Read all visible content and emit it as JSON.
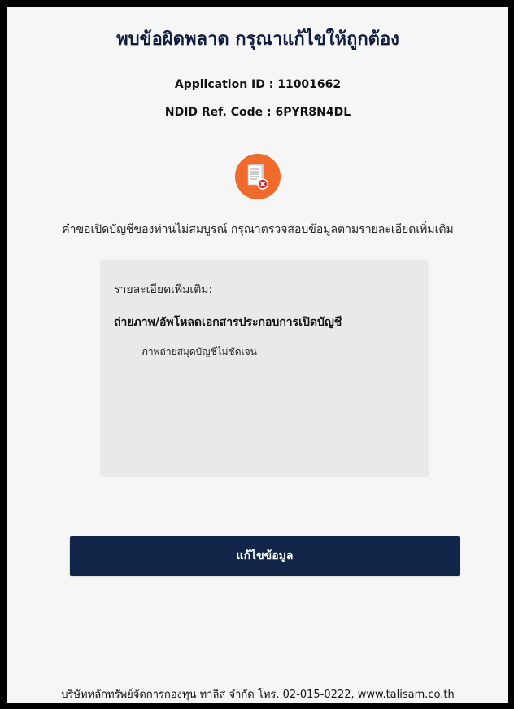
{
  "page": {
    "title": "พบข้อผิดพลาด กรุณาแก้ไขให้ถูกต้อง",
    "application_id": "Application ID : 11001662",
    "ndid_ref_code": "NDID Ref. Code : 6PYR8N4DL",
    "status_icon": "document-error-icon",
    "message": "คำขอเปิดบัญชีของท่านไม่สมบูรณ์ กรุณาตรวจสอบข้อมูลตามรายละเอียดเพิ่มเติม"
  },
  "details": {
    "heading": "รายละเอียดเพิ่มเติม:",
    "section_title": "ถ่ายภาพ/อัพโหลดเอกสารประกอบการเปิดบัญชี",
    "items": [
      "ภาพถ่ายสมุดบัญชีไม่ชัดเจน"
    ]
  },
  "actions": {
    "fix_label": "แก้ไขข้อมูล"
  },
  "footer": {
    "text": "บริษัทหลักทรัพย์จัดการกองทุน ทาลิส จำกัด โทร. 02-015-0222, www.talisam.co.th"
  },
  "colors": {
    "accent_orange": "#ef6a2b",
    "navy": "#112548",
    "panel_gray": "#e9e9e9"
  }
}
